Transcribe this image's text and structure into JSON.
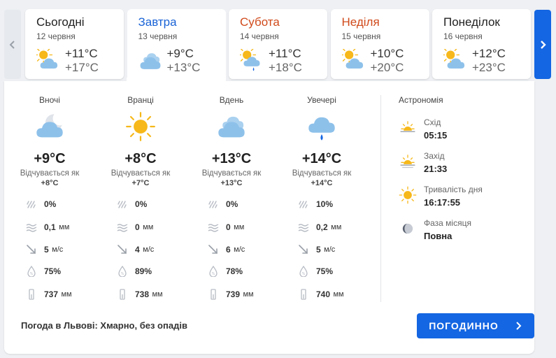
{
  "days": [
    {
      "name": "Сьогодні",
      "date": "12 червня",
      "t_min": "+11°C",
      "t_max": "+17°C",
      "icon": "sun-cloud-icon",
      "style": "weekday",
      "active": false
    },
    {
      "name": "Завтра",
      "date": "13 червня",
      "t_min": "+9°C",
      "t_max": "+13°C",
      "icon": "cloudy-icon",
      "style": "active",
      "active": true
    },
    {
      "name": "Субота",
      "date": "14 червня",
      "t_min": "+11°C",
      "t_max": "+18°C",
      "icon": "sun-cloud-rain-icon",
      "style": "weekend",
      "active": false
    },
    {
      "name": "Неділя",
      "date": "15 червня",
      "t_min": "+10°C",
      "t_max": "+20°C",
      "icon": "sun-cloud-icon",
      "style": "weekend",
      "active": false
    },
    {
      "name": "Понеділок",
      "date": "16 червня",
      "t_min": "+12°C",
      "t_max": "+23°C",
      "icon": "sun-cloud-icon",
      "style": "weekday",
      "active": false
    }
  ],
  "feels_label": "Відчувається як",
  "periods": [
    {
      "label": "Вночі",
      "icon": "moon-cloud-icon",
      "temp": "+9°C",
      "feels": "+8°C",
      "precip_prob": "0%",
      "precip_amount": "0,1",
      "precip_unit": "мм",
      "wind": "5",
      "wind_unit": "м/с",
      "humidity": "75%",
      "pressure": "737",
      "pressure_unit": "мм"
    },
    {
      "label": "Вранці",
      "icon": "sun-icon",
      "temp": "+8°C",
      "feels": "+7°C",
      "precip_prob": "0%",
      "precip_amount": "0",
      "precip_unit": "мм",
      "wind": "4",
      "wind_unit": "м/с",
      "humidity": "89%",
      "pressure": "738",
      "pressure_unit": "мм"
    },
    {
      "label": "Вдень",
      "icon": "cloudy-icon",
      "temp": "+13°C",
      "feels": "+13°C",
      "precip_prob": "0%",
      "precip_amount": "0",
      "precip_unit": "мм",
      "wind": "6",
      "wind_unit": "м/с",
      "humidity": "78%",
      "pressure": "739",
      "pressure_unit": "мм"
    },
    {
      "label": "Увечері",
      "icon": "cloud-rain-icon",
      "temp": "+14°C",
      "feels": "+14°C",
      "precip_prob": "10%",
      "precip_amount": "0,2",
      "precip_unit": "мм",
      "wind": "5",
      "wind_unit": "м/с",
      "humidity": "75%",
      "pressure": "740",
      "pressure_unit": "мм"
    }
  ],
  "astronomy": {
    "title": "Астрономія",
    "sunrise_label": "Схід",
    "sunrise": "05:15",
    "sunset_label": "Захід",
    "sunset": "21:33",
    "daylength_label": "Тривалість дня",
    "daylength": "16:17:55",
    "moon_label": "Фаза місяця",
    "moon": "Повна"
  },
  "summary": "Погода в Львові: Хмарно, без опадів",
  "hourly_button": "ПОГОДИННО",
  "colors": {
    "accent": "#1466e2",
    "weekend": "#d04a1b",
    "active_day": "#1a63d6",
    "sun": "#f6b81a",
    "cloud": "#8ec1ea"
  }
}
